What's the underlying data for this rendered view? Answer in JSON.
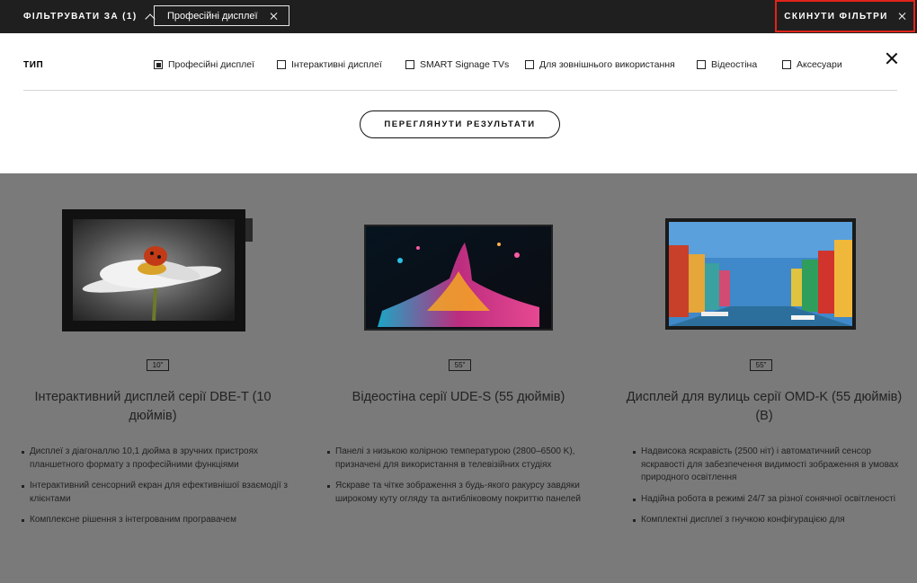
{
  "topbar": {
    "filter_by_label": "ФІЛЬТРУВАТИ ЗА (1)",
    "active_chip_label": "Професійні дисплеї",
    "reset_label": "СКИНУТИ ФІЛЬТРИ"
  },
  "filter_panel": {
    "type_label": "ТИП",
    "options": [
      {
        "label": "Професійні дисплеї",
        "checked": true
      },
      {
        "label": "Інтерактивні дисплеї",
        "checked": false
      },
      {
        "label": "SMART Signage TVs",
        "checked": false
      },
      {
        "label": "Для зовнішнього використання",
        "checked": false
      },
      {
        "label": "Відеостіна",
        "checked": false
      },
      {
        "label": "Аксесуари",
        "checked": false
      }
    ],
    "view_results_label": "ПЕРЕГЛЯНУТИ РЕЗУЛЬТАТИ"
  },
  "products": [
    {
      "size": "10\"",
      "name": "Інтерактивний дисплей серії DBE-T (10 дюймів)",
      "bullets": [
        "Дисплеї з діагоналлю 10,1 дюйма в зручних пристроях планшетного формату з професійними функціями",
        "Інтерактивний сенсорний екран для ефективнішої взаємодії з клієнтами",
        "Комплексне рішення з інтегрованим програвачем"
      ]
    },
    {
      "size": "55\"",
      "name": "Відеостіна серії UDE-S (55 дюймів)",
      "bullets": [
        "Панелі з низькою колірною температурою (2800–6500 K), призначені для використання в телевізійних студіях",
        "Яскраве та чітке зображення з будь-якого ракурсу завдяки широкому куту огляду та антибліковому покриттю панелей"
      ]
    },
    {
      "size": "55\"",
      "name": "Дисплей для вулиць серії OMD-K (55 дюймів) (B)",
      "bullets": [
        "Надвисока яскравість (2500 ніт) і автоматичний сенсор яскравості для забезпечення видимості зображення в умовах природного освітлення",
        "Надійна робота в режимі 24/7 за різної сонячної освітленості",
        "Комплектні дисплеї з гнучкою конфігурацією для"
      ]
    }
  ],
  "colors": {
    "topbar_bg": "#1f1f1f",
    "overlay_bg": "#7a7a7a",
    "highlight_border": "#e2231a"
  }
}
